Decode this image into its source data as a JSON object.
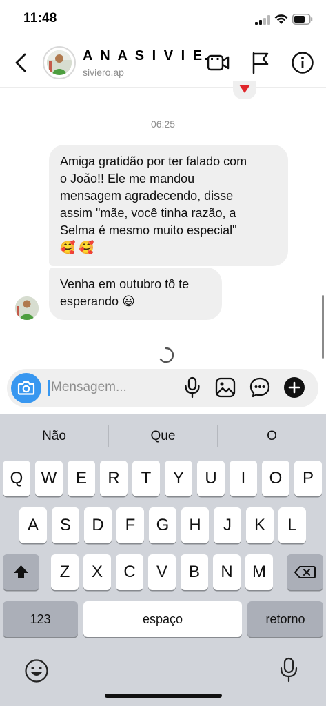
{
  "status_bar": {
    "time": "11:48"
  },
  "header": {
    "contact_name": "A N A  S I V I E...",
    "username": "siviero.ap"
  },
  "chat": {
    "timestamp": "06:25",
    "messages": [
      {
        "lines": [
          "Amiga gratidão por ter falado com",
          "o João!! Ele me mandou",
          "mensagem agradecendo, disse",
          "assim \"mãe, você tinha razão, a",
          "Selma é mesmo muito especial\"",
          "🥰 🥰"
        ]
      },
      {
        "lines": [
          "Venha em outubro tô te",
          "esperando 😃"
        ]
      }
    ]
  },
  "composer": {
    "placeholder": "Mensagem..."
  },
  "keyboard": {
    "suggestions": [
      "Não",
      "Que",
      "O"
    ],
    "row1": [
      "Q",
      "W",
      "E",
      "R",
      "T",
      "Y",
      "U",
      "I",
      "O",
      "P"
    ],
    "row2": [
      "A",
      "S",
      "D",
      "F",
      "G",
      "H",
      "J",
      "K",
      "L"
    ],
    "row3": [
      "Z",
      "X",
      "C",
      "V",
      "B",
      "N",
      "M"
    ],
    "numbers_key": "123",
    "space_key": "espaço",
    "return_key": "retorno"
  },
  "colors": {
    "accent": "#3897f0",
    "bubble": "#efefef",
    "keyboard_bg": "#d1d4da",
    "reaction": "#e0262b"
  }
}
